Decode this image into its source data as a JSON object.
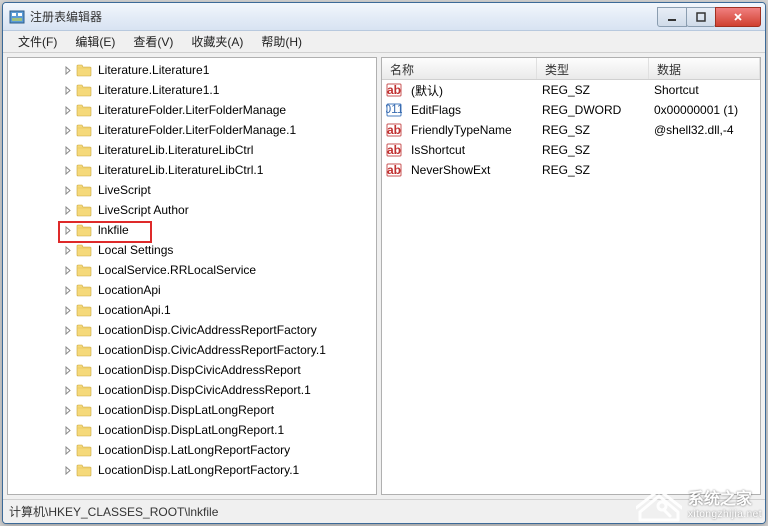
{
  "window": {
    "title": "注册表编辑器"
  },
  "menubar": [
    {
      "label": "文件(F)"
    },
    {
      "label": "编辑(E)"
    },
    {
      "label": "查看(V)"
    },
    {
      "label": "收藏夹(A)"
    },
    {
      "label": "帮助(H)"
    }
  ],
  "tree": {
    "items": [
      {
        "label": "Literature.Literature1"
      },
      {
        "label": "Literature.Literature1.1"
      },
      {
        "label": "LiteratureFolder.LiterFolderManage"
      },
      {
        "label": "LiteratureFolder.LiterFolderManage.1"
      },
      {
        "label": "LiteratureLib.LiteratureLibCtrl"
      },
      {
        "label": "LiteratureLib.LiteratureLibCtrl.1"
      },
      {
        "label": "LiveScript"
      },
      {
        "label": "LiveScript Author"
      },
      {
        "label": "lnkfile",
        "highlighted": true
      },
      {
        "label": "Local Settings"
      },
      {
        "label": "LocalService.RRLocalService"
      },
      {
        "label": "LocationApi"
      },
      {
        "label": "LocationApi.1"
      },
      {
        "label": "LocationDisp.CivicAddressReportFactory"
      },
      {
        "label": "LocationDisp.CivicAddressReportFactory.1"
      },
      {
        "label": "LocationDisp.DispCivicAddressReport"
      },
      {
        "label": "LocationDisp.DispCivicAddressReport.1"
      },
      {
        "label": "LocationDisp.DispLatLongReport"
      },
      {
        "label": "LocationDisp.DispLatLongReport.1"
      },
      {
        "label": "LocationDisp.LatLongReportFactory"
      },
      {
        "label": "LocationDisp.LatLongReportFactory.1"
      }
    ]
  },
  "list": {
    "columns": {
      "name": "名称",
      "type": "类型",
      "data": "数据"
    },
    "rows": [
      {
        "icon": "string",
        "name": "(默认)",
        "type": "REG_SZ",
        "data": "Shortcut"
      },
      {
        "icon": "binary",
        "name": "EditFlags",
        "type": "REG_DWORD",
        "data": "0x00000001 (1)"
      },
      {
        "icon": "string",
        "name": "FriendlyTypeName",
        "type": "REG_SZ",
        "data": "@shell32.dll,-4"
      },
      {
        "icon": "string",
        "name": "IsShortcut",
        "type": "REG_SZ",
        "data": ""
      },
      {
        "icon": "string",
        "name": "NeverShowExt",
        "type": "REG_SZ",
        "data": ""
      }
    ]
  },
  "statusbar": {
    "path": "计算机\\HKEY_CLASSES_ROOT\\lnkfile"
  },
  "watermark": {
    "text": "系统之家",
    "sub": "xitongzhijia.net"
  }
}
